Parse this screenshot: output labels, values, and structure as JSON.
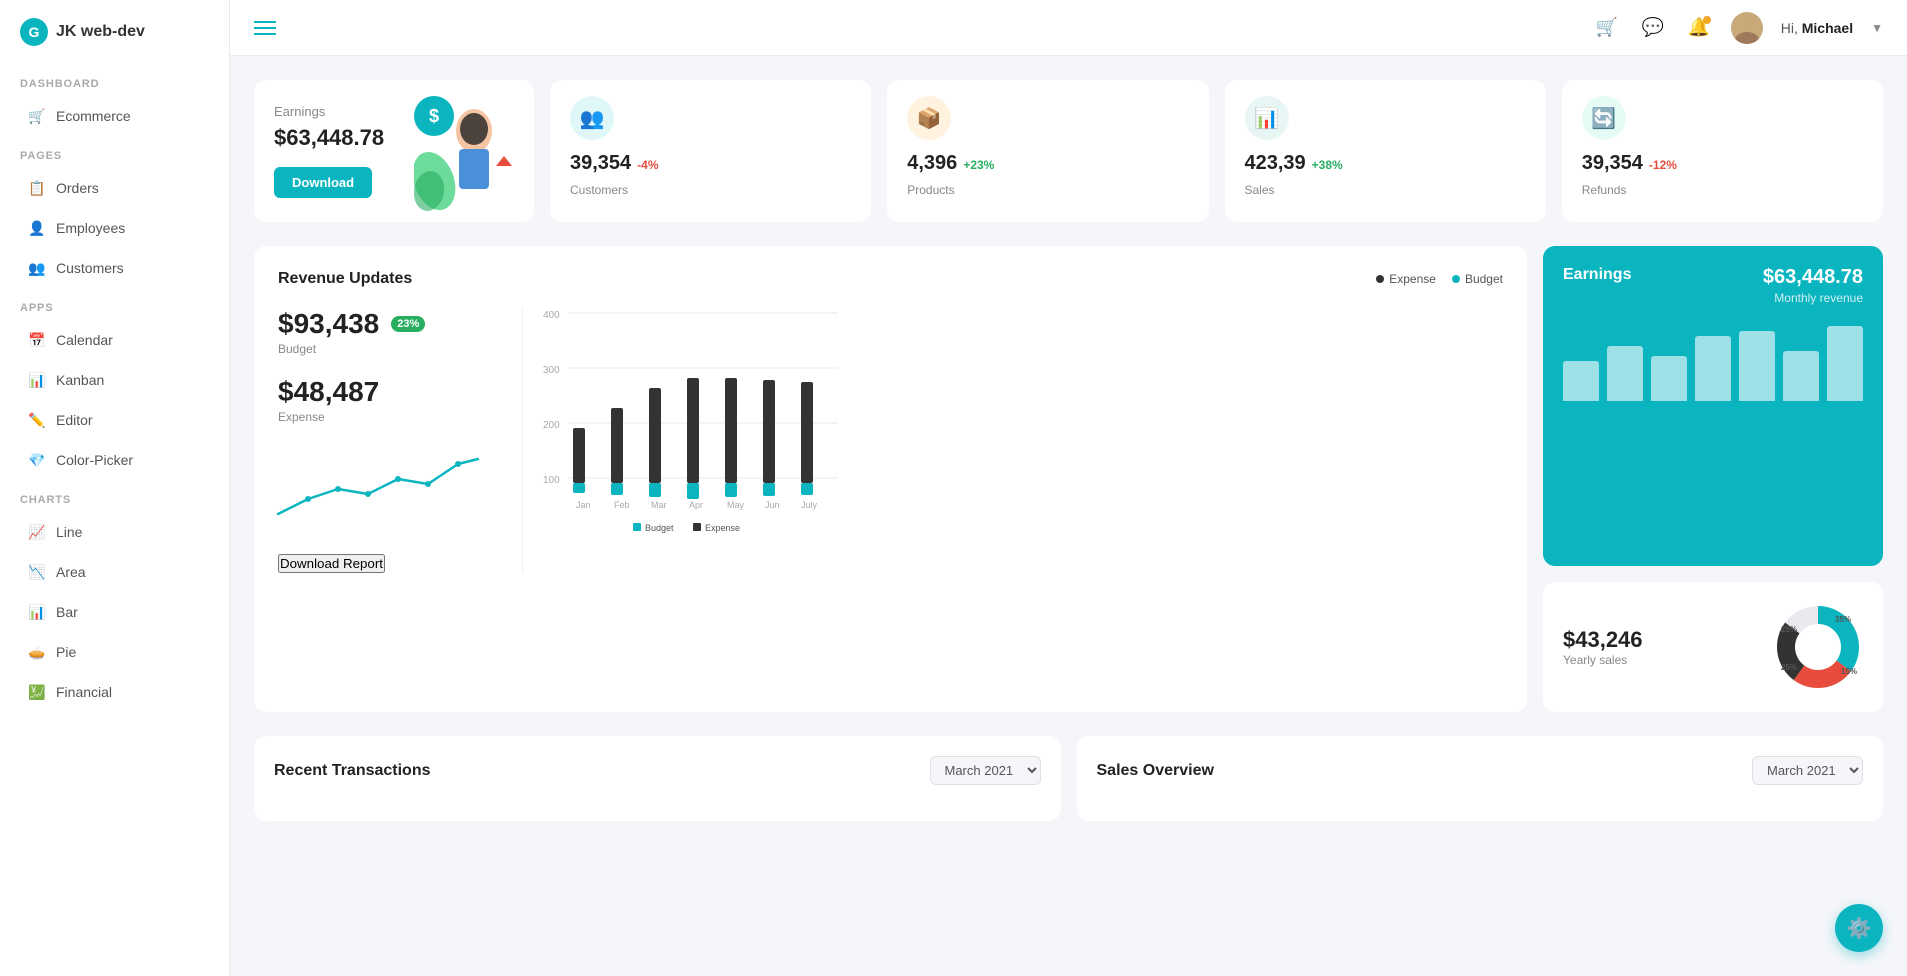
{
  "sidebar": {
    "logo": "JK web-dev",
    "sections": [
      {
        "label": "DASHBOARD",
        "items": [
          {
            "id": "ecommerce",
            "label": "Ecommerce",
            "icon": "🛒"
          }
        ]
      },
      {
        "label": "PAGES",
        "items": [
          {
            "id": "orders",
            "label": "Orders",
            "icon": "📋"
          },
          {
            "id": "employees",
            "label": "Employees",
            "icon": "👤"
          },
          {
            "id": "customers",
            "label": "Customers",
            "icon": "👥"
          }
        ]
      },
      {
        "label": "APPS",
        "items": [
          {
            "id": "calendar",
            "label": "Calendar",
            "icon": "📅"
          },
          {
            "id": "kanban",
            "label": "Kanban",
            "icon": "📊"
          },
          {
            "id": "editor",
            "label": "Editor",
            "icon": "✏️"
          },
          {
            "id": "color-picker",
            "label": "Color-Picker",
            "icon": "💎"
          }
        ]
      },
      {
        "label": "CHARTS",
        "items": [
          {
            "id": "line",
            "label": "Line",
            "icon": "📈"
          },
          {
            "id": "area",
            "label": "Area",
            "icon": "📉"
          },
          {
            "id": "bar",
            "label": "Bar",
            "icon": "📊"
          },
          {
            "id": "pie",
            "label": "Pie",
            "icon": "🥧"
          },
          {
            "id": "financial",
            "label": "Financial",
            "icon": "💹"
          }
        ]
      }
    ]
  },
  "topbar": {
    "hamburger_visible": true,
    "greeting": "Hi,",
    "username": "Michael"
  },
  "stats": {
    "earnings": {
      "label": "Earnings",
      "value": "$63,448.78",
      "download_btn": "Download"
    },
    "customers": {
      "value": "39,354",
      "change": "-4%",
      "change_type": "neg",
      "label": "Customers"
    },
    "products": {
      "value": "4,396",
      "change": "+23%",
      "change_type": "pos",
      "label": "Products"
    },
    "sales": {
      "value": "423,39",
      "change": "+38%",
      "change_type": "pos",
      "label": "Sales"
    },
    "refunds": {
      "value": "39,354",
      "change": "-12%",
      "change_type": "neg",
      "label": "Refunds"
    }
  },
  "revenue": {
    "title": "Revenue Updates",
    "legend_expense": "Expense",
    "legend_budget": "Budget",
    "budget_value": "$93,438",
    "budget_badge": "23%",
    "budget_label": "Budget",
    "expense_value": "$48,487",
    "expense_label": "Expense",
    "download_report_btn": "Download Report",
    "bar_months": [
      "Jan",
      "Feb",
      "Mar",
      "Apr",
      "May",
      "Jun",
      "July"
    ],
    "bar_budget_legend": "Budget",
    "bar_expense_legend": "Expense"
  },
  "earnings_card": {
    "title": "Earnings",
    "value": "$63,448.78",
    "subtitle": "Monthly revenue"
  },
  "yearly_sales": {
    "value": "$43,246",
    "label": "Yearly sales",
    "donut_segments": [
      {
        "label": "25%",
        "color": "#e74c3c"
      },
      {
        "label": "35%",
        "color": "#0bb5c0"
      },
      {
        "label": "25%",
        "color": "#333"
      },
      {
        "label": "15%",
        "color": "#f5f6fa"
      }
    ]
  },
  "transactions": {
    "title": "Recent Transactions",
    "month_select": "March 2021"
  },
  "sales_overview": {
    "title": "Sales Overview",
    "month_select": "March 2021"
  }
}
